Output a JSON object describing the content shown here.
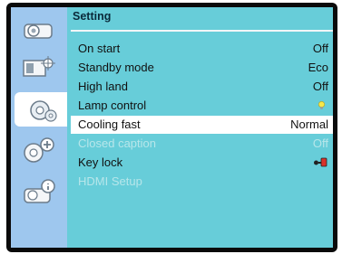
{
  "menu": {
    "title": "Setting",
    "items": [
      {
        "label": "On start",
        "value": "Off"
      },
      {
        "label": "Standby mode",
        "value": "Eco"
      },
      {
        "label": "High land",
        "value": "Off"
      },
      {
        "label": "Lamp control",
        "value": "",
        "value_icon": "bulb-icon"
      },
      {
        "label": "Cooling fast",
        "value": "Normal",
        "selected": true
      },
      {
        "label": "Closed caption",
        "value": "Off",
        "disabled": true
      },
      {
        "label": "Key lock",
        "value": "",
        "value_icon": "key-lock-icon"
      },
      {
        "label": "HDMI Setup",
        "value": "",
        "disabled": true
      }
    ]
  },
  "sidebar": {
    "tabs": [
      {
        "icon": "projector-icon"
      },
      {
        "icon": "image-adjust-icon"
      },
      {
        "icon": "settings-gear-icon",
        "active": true
      },
      {
        "icon": "expanded-settings-icon"
      },
      {
        "icon": "info-icon"
      }
    ]
  },
  "colors": {
    "panel": "#67cdd9",
    "sidebar": "#9ec7ee",
    "selected_row": "#ffffff",
    "disabled_text": "#b7e6ea",
    "frame": "#0a0a0a"
  }
}
